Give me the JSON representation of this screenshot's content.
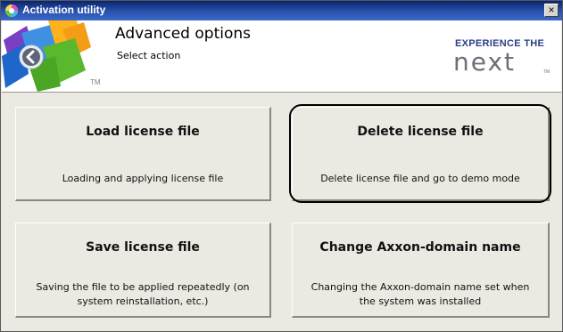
{
  "window": {
    "title": "Activation utility",
    "close_glyph": "×"
  },
  "header": {
    "title": "Advanced options",
    "subtitle": "Select action",
    "logo_tm": "TM",
    "brand_tagline": "EXPERIENCE THE",
    "brand_word": "next",
    "brand_tm": "TM",
    "back_icon": "chevron-left-icon"
  },
  "actions": [
    {
      "title": "Load license file",
      "description": "Loading and applying license file"
    },
    {
      "title": "Delete license file",
      "description": "Delete license file and go to demo mode"
    },
    {
      "title": "Save license file",
      "description_line1": "Saving the file to be applied repeatedly (on",
      "description_line2": "system reinstallation, etc.)"
    },
    {
      "title": "Change Axxon-domain name",
      "description_line1": "Changing the Axxon-domain name set when",
      "description_line2": "the system was installed"
    }
  ],
  "colors": {
    "titlebar": "#0a246a",
    "brand_blue": "#2a3f86",
    "brand_grey": "#6b7077",
    "panel": "#ece9e2"
  }
}
